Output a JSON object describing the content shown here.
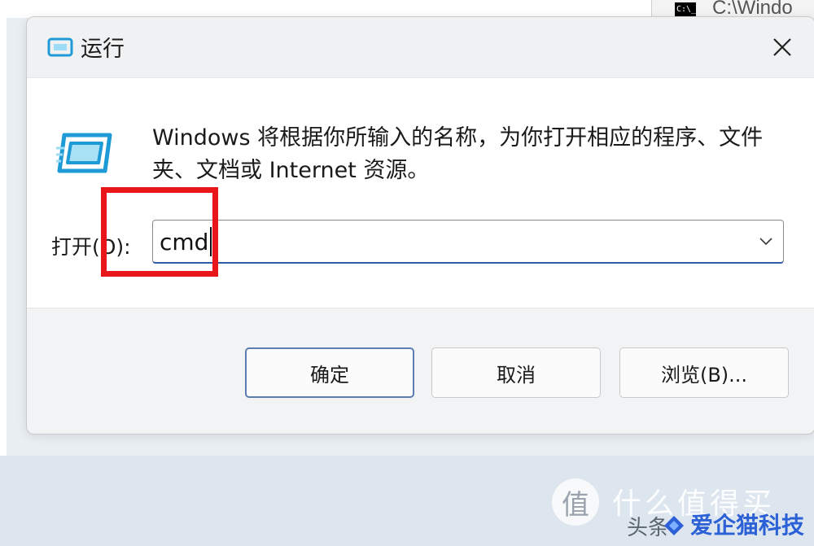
{
  "background_window": {
    "title": "C:\\Windo",
    "icon_text": "C:\\_"
  },
  "dialog": {
    "title": "运行",
    "description": "Windows 将根据你所输入的名称，为你打开相应的程序、文件夹、文档或 Internet 资源。",
    "open_label": "打开(O):",
    "input_value": "cmd",
    "buttons": {
      "ok": "确定",
      "cancel": "取消",
      "browse": "浏览(B)..."
    }
  },
  "watermark": {
    "circle_char": "值",
    "line1": "什么值得买",
    "line2": "头条",
    "brand": "爱企猫科技"
  },
  "colors": {
    "highlight": "#e8151b",
    "accent": "#2f5aa8",
    "icon": "#1e9bd7"
  },
  "icons": [
    "run-app-icon",
    "close-icon",
    "chevron-down-icon",
    "cmd-icon"
  ]
}
